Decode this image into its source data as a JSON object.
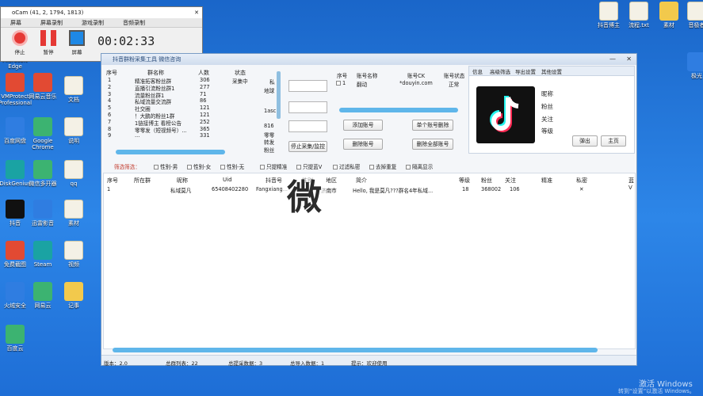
{
  "ocam": {
    "title": "oCam (41, 2, 1794, 1813)",
    "tabs": [
      "屏幕",
      "屏幕录制",
      "游戏录制",
      "音频录制"
    ],
    "stop_label": "停止",
    "pause_label": "暂停",
    "screen_label": "屏幕",
    "timer": "00:02:33"
  },
  "desktop_right": [
    "抖音博主",
    "流程.txt",
    "素材",
    "音极者",
    "极光"
  ],
  "desktop_left": [
    "Microsoft Edge",
    "VMProtect Professional",
    "百度网盘",
    "DiskGenius",
    "抖音",
    "免费截图",
    "火绒安全",
    "迅雷",
    "百度云"
  ],
  "desktop_col2": [
    "网易云音乐",
    "Google Chrome",
    "微信多开器",
    "迅雷影音",
    "Steam",
    "网易云"
  ],
  "desktop_col3": [
    "文档",
    "说明",
    "bbb",
    "qq",
    "素材",
    "视频",
    "记事"
  ],
  "window": {
    "title": "抖音群粉采集工具 微信咨询",
    "left_headers": [
      "序号",
      "群名称",
      "人数",
      "状态"
    ],
    "groups": [
      {
        "no": "1",
        "name": "精准拓客粉丝群",
        "count": "306",
        "status": "采集中"
      },
      {
        "no": "2",
        "name": "直播引流粉丝群1",
        "count": "277",
        "status": ""
      },
      {
        "no": "3",
        "name": "流量粉丝群1",
        "count": "71",
        "status": ""
      },
      {
        "no": "4",
        "name": "私域流量交流群",
        "count": "86",
        "status": ""
      },
      {
        "no": "5",
        "name": "社交圈",
        "count": "121",
        "status": ""
      },
      {
        "no": "6",
        "name": "！大鹏的粉丝1群",
        "count": "121",
        "status": ""
      },
      {
        "no": "7",
        "name": "1链接博主 看榜公告",
        "count": "252",
        "status": ""
      },
      {
        "no": "8",
        "name": "零零发（短视频号）...",
        "count": "365",
        "status": ""
      },
      {
        "no": "9",
        "name": "...",
        "count": "331",
        "status": ""
      }
    ],
    "mid_snippets": [
      "私",
      "地球",
      "1asc",
      "816",
      "零零",
      "转发",
      "粉丝"
    ],
    "stop_button": "停止采集/监控",
    "acc_headers": [
      "序号",
      "账号名称",
      "账号CK",
      "账号状态"
    ],
    "account": {
      "no": "1",
      "name": "翻动",
      "ck": "*douyin.com",
      "status": "正常"
    },
    "add_account": "添加账号",
    "delete_single": "单个账号删除",
    "delete_account": "删除账号",
    "delete_all": "删除全部账号",
    "right_tabs": [
      "信息",
      "高级筛选",
      "导出设置",
      "其他设置"
    ],
    "profile_labels": [
      "昵称",
      "粉丝",
      "关注",
      "等级"
    ],
    "profile_btn1": "弹出",
    "profile_btn2": "主页",
    "filter_label": "筛选筛选：",
    "filters": [
      "性别-男",
      "性别-女",
      "性别-无",
      "只提精准",
      "只提蓝V",
      "过滤私密",
      "去掉重复",
      "隔离显示"
    ],
    "res_headers": [
      "序号",
      "所在群",
      "昵称",
      "Uid",
      "抖音号",
      "性别",
      "地区",
      "简介",
      "等级",
      "粉丝",
      "关注",
      "精准",
      "私密",
      "蓝V"
    ],
    "result": {
      "no": "1",
      "group": "",
      "nick": "私域莫凡",
      "uid": "65408402280",
      "dy": "Fangxiang...",
      "sex": "",
      "area": "济南市",
      "intro": "Hello, 我是莫凡???群名4年私域...",
      "level": "18",
      "fans": "368002",
      "follow": "106",
      "precise": "",
      "private": "✕"
    },
    "status": {
      "version": "版本：2.0",
      "total_lists": "总群列表：22",
      "total_collect": "总提采数据：3",
      "total_import": "总导入数据：1",
      "tip": "提示：欢迎使用"
    }
  },
  "overlay_char": "微",
  "watermark": {
    "line1": "激活 Windows",
    "line2": "转到“设置”以激活 Windows。"
  },
  "colors": {
    "accent": "#5fb6ea",
    "desktop": "#2d86e8"
  }
}
